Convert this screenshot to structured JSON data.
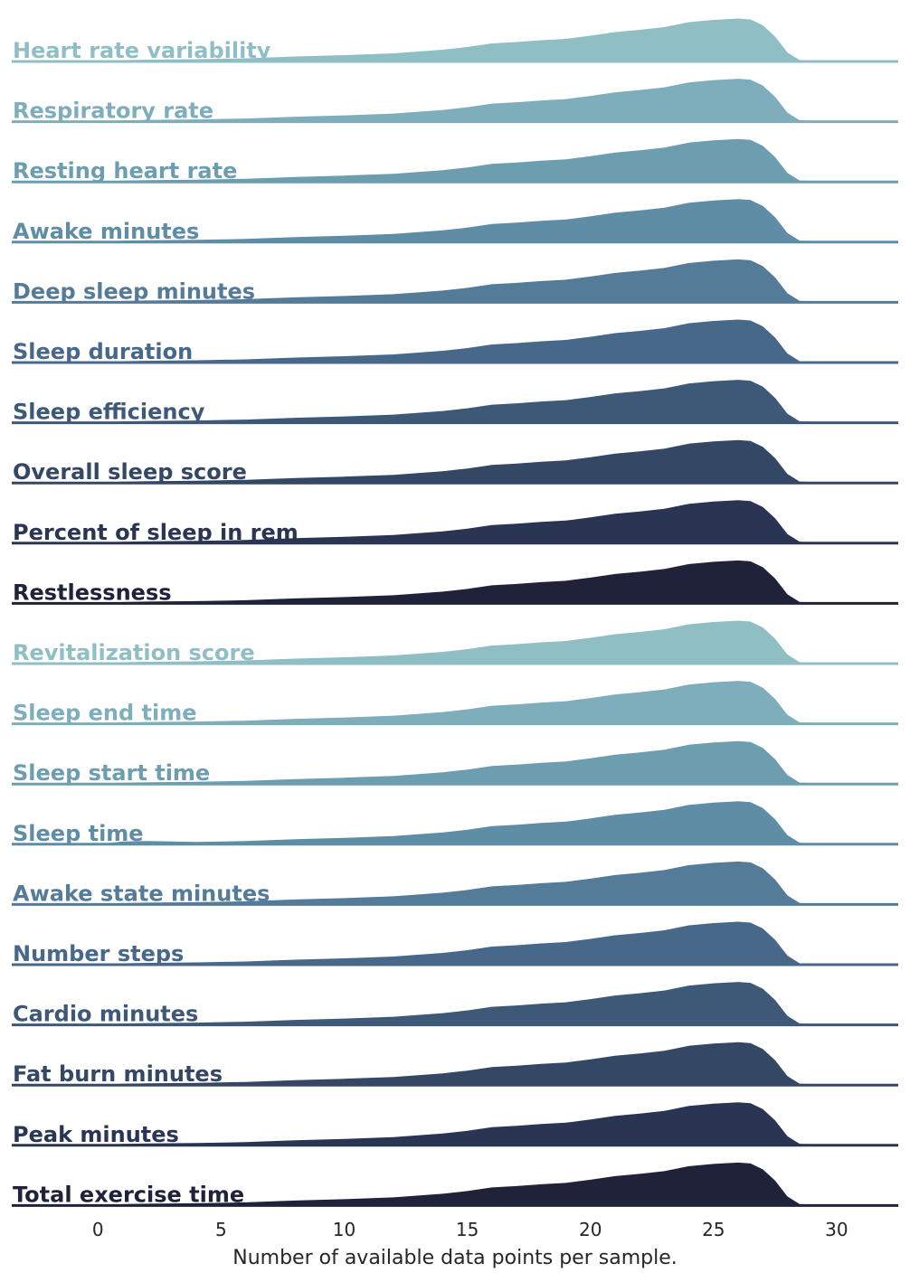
{
  "chart_data": {
    "type": "ridgeline",
    "xlabel": "Number of available data points per sample.",
    "xlim": [
      -3.5,
      32.5
    ],
    "xticks": [
      0,
      5,
      10,
      15,
      20,
      25,
      30
    ],
    "grid": false,
    "legend": "none",
    "density_grid_x": [
      -2,
      0,
      1,
      2,
      4,
      6,
      8,
      10,
      12,
      14,
      15,
      16,
      17,
      18,
      19,
      20,
      21,
      22,
      23,
      24,
      25,
      26,
      26.5,
      27,
      27.5,
      28,
      28.5,
      30.5
    ],
    "series": [
      {
        "name": "Heart rate variability",
        "color": "#8fbfc4",
        "density": [
          0,
          0,
          0.03,
          0.04,
          0.05,
          0.07,
          0.11,
          0.14,
          0.18,
          0.26,
          0.32,
          0.4,
          0.43,
          0.47,
          0.5,
          0.57,
          0.65,
          0.7,
          0.76,
          0.87,
          0.92,
          0.95,
          0.93,
          0.8,
          0.55,
          0.2,
          0.03,
          0
        ]
      },
      {
        "name": "Respiratory rate",
        "color": "#7eaebb",
        "density": [
          0,
          0,
          0.03,
          0.04,
          0.05,
          0.07,
          0.11,
          0.14,
          0.18,
          0.26,
          0.32,
          0.4,
          0.43,
          0.47,
          0.5,
          0.57,
          0.65,
          0.7,
          0.76,
          0.87,
          0.92,
          0.95,
          0.93,
          0.8,
          0.55,
          0.2,
          0.03,
          0
        ]
      },
      {
        "name": "Resting heart rate",
        "color": "#6d9eb0",
        "density": [
          0,
          0,
          0.03,
          0.04,
          0.05,
          0.07,
          0.11,
          0.14,
          0.18,
          0.26,
          0.32,
          0.4,
          0.43,
          0.47,
          0.5,
          0.57,
          0.65,
          0.7,
          0.76,
          0.87,
          0.92,
          0.95,
          0.93,
          0.8,
          0.55,
          0.2,
          0.03,
          0
        ]
      },
      {
        "name": "Awake minutes",
        "color": "#5f8da6",
        "density": [
          0,
          0,
          0.03,
          0.04,
          0.05,
          0.07,
          0.11,
          0.14,
          0.18,
          0.26,
          0.32,
          0.4,
          0.43,
          0.47,
          0.5,
          0.57,
          0.65,
          0.7,
          0.76,
          0.87,
          0.92,
          0.95,
          0.93,
          0.8,
          0.55,
          0.2,
          0.03,
          0
        ]
      },
      {
        "name": "Deep sleep minutes",
        "color": "#547b98",
        "density": [
          0,
          0,
          0.03,
          0.04,
          0.05,
          0.07,
          0.11,
          0.14,
          0.18,
          0.26,
          0.32,
          0.4,
          0.43,
          0.47,
          0.5,
          0.57,
          0.65,
          0.7,
          0.76,
          0.87,
          0.92,
          0.95,
          0.93,
          0.8,
          0.55,
          0.2,
          0.03,
          0
        ]
      },
      {
        "name": "Sleep duration",
        "color": "#486889",
        "density": [
          0,
          0,
          0.03,
          0.04,
          0.05,
          0.07,
          0.11,
          0.14,
          0.18,
          0.26,
          0.32,
          0.4,
          0.43,
          0.47,
          0.5,
          0.57,
          0.65,
          0.7,
          0.76,
          0.87,
          0.92,
          0.95,
          0.93,
          0.8,
          0.55,
          0.2,
          0.03,
          0
        ]
      },
      {
        "name": "Sleep efficiency",
        "color": "#3e5878",
        "density": [
          0,
          0,
          0.03,
          0.04,
          0.05,
          0.07,
          0.11,
          0.14,
          0.18,
          0.26,
          0.32,
          0.4,
          0.43,
          0.47,
          0.5,
          0.57,
          0.65,
          0.7,
          0.76,
          0.87,
          0.92,
          0.95,
          0.93,
          0.8,
          0.55,
          0.2,
          0.03,
          0
        ]
      },
      {
        "name": "Overall sleep score",
        "color": "#344866",
        "density": [
          0,
          0,
          0.03,
          0.04,
          0.05,
          0.07,
          0.11,
          0.14,
          0.18,
          0.26,
          0.32,
          0.4,
          0.43,
          0.47,
          0.5,
          0.57,
          0.65,
          0.7,
          0.76,
          0.87,
          0.92,
          0.95,
          0.93,
          0.8,
          0.55,
          0.2,
          0.03,
          0
        ]
      },
      {
        "name": "Percent of sleep in rem",
        "color": "#2a3554",
        "density": [
          0,
          0,
          0.03,
          0.04,
          0.05,
          0.07,
          0.11,
          0.14,
          0.18,
          0.26,
          0.32,
          0.4,
          0.43,
          0.47,
          0.5,
          0.57,
          0.65,
          0.7,
          0.76,
          0.87,
          0.92,
          0.95,
          0.93,
          0.8,
          0.55,
          0.2,
          0.03,
          0
        ]
      },
      {
        "name": "Restlessness",
        "color": "#20223a",
        "density": [
          0,
          0,
          0.03,
          0.04,
          0.05,
          0.07,
          0.11,
          0.14,
          0.18,
          0.26,
          0.32,
          0.4,
          0.43,
          0.47,
          0.5,
          0.57,
          0.65,
          0.7,
          0.76,
          0.87,
          0.92,
          0.95,
          0.93,
          0.8,
          0.55,
          0.2,
          0.03,
          0
        ]
      },
      {
        "name": "Revitalization score",
        "color": "#8fbfc4",
        "density": [
          0,
          0,
          0.03,
          0.04,
          0.05,
          0.07,
          0.11,
          0.14,
          0.18,
          0.26,
          0.32,
          0.4,
          0.43,
          0.47,
          0.5,
          0.57,
          0.65,
          0.7,
          0.76,
          0.87,
          0.92,
          0.95,
          0.93,
          0.8,
          0.55,
          0.2,
          0.03,
          0
        ]
      },
      {
        "name": "Sleep end time",
        "color": "#7eaebb",
        "density": [
          0,
          0,
          0.03,
          0.04,
          0.05,
          0.07,
          0.11,
          0.14,
          0.18,
          0.26,
          0.32,
          0.4,
          0.43,
          0.47,
          0.5,
          0.57,
          0.65,
          0.7,
          0.76,
          0.87,
          0.92,
          0.95,
          0.93,
          0.8,
          0.55,
          0.2,
          0.03,
          0
        ]
      },
      {
        "name": "Sleep start time",
        "color": "#6d9eb0",
        "density": [
          0,
          0,
          0.03,
          0.04,
          0.05,
          0.07,
          0.11,
          0.14,
          0.18,
          0.26,
          0.32,
          0.4,
          0.43,
          0.47,
          0.5,
          0.57,
          0.65,
          0.7,
          0.76,
          0.87,
          0.92,
          0.95,
          0.93,
          0.8,
          0.55,
          0.2,
          0.03,
          0
        ]
      },
      {
        "name": "Sleep time",
        "color": "#5f8da6",
        "density": [
          0,
          0,
          0.06,
          0.07,
          0.05,
          0.07,
          0.11,
          0.14,
          0.18,
          0.26,
          0.32,
          0.4,
          0.43,
          0.47,
          0.5,
          0.57,
          0.65,
          0.7,
          0.76,
          0.87,
          0.92,
          0.95,
          0.93,
          0.8,
          0.55,
          0.2,
          0.03,
          0
        ]
      },
      {
        "name": "Awake state minutes",
        "color": "#547b98",
        "density": [
          0,
          0,
          0.03,
          0.04,
          0.05,
          0.07,
          0.11,
          0.14,
          0.18,
          0.26,
          0.32,
          0.4,
          0.43,
          0.47,
          0.5,
          0.57,
          0.65,
          0.7,
          0.76,
          0.87,
          0.92,
          0.95,
          0.93,
          0.8,
          0.55,
          0.2,
          0.03,
          0
        ]
      },
      {
        "name": "Number steps",
        "color": "#486889",
        "density": [
          0,
          0,
          0.03,
          0.04,
          0.05,
          0.07,
          0.11,
          0.14,
          0.18,
          0.26,
          0.32,
          0.4,
          0.43,
          0.47,
          0.5,
          0.57,
          0.65,
          0.7,
          0.76,
          0.87,
          0.92,
          0.95,
          0.93,
          0.8,
          0.55,
          0.2,
          0.03,
          0
        ]
      },
      {
        "name": "Cardio minutes",
        "color": "#3e5878",
        "density": [
          0,
          0,
          0.03,
          0.04,
          0.05,
          0.07,
          0.11,
          0.14,
          0.18,
          0.26,
          0.32,
          0.4,
          0.43,
          0.47,
          0.5,
          0.57,
          0.65,
          0.7,
          0.76,
          0.87,
          0.92,
          0.95,
          0.93,
          0.8,
          0.55,
          0.2,
          0.03,
          0
        ]
      },
      {
        "name": "Fat burn minutes",
        "color": "#344866",
        "density": [
          0,
          0,
          0.03,
          0.04,
          0.05,
          0.07,
          0.11,
          0.14,
          0.18,
          0.26,
          0.32,
          0.4,
          0.43,
          0.47,
          0.5,
          0.57,
          0.65,
          0.7,
          0.76,
          0.87,
          0.92,
          0.95,
          0.93,
          0.8,
          0.55,
          0.2,
          0.03,
          0
        ]
      },
      {
        "name": "Peak minutes",
        "color": "#2a3554",
        "density": [
          0,
          0,
          0.03,
          0.04,
          0.05,
          0.07,
          0.11,
          0.14,
          0.18,
          0.26,
          0.32,
          0.4,
          0.43,
          0.47,
          0.5,
          0.57,
          0.65,
          0.7,
          0.76,
          0.87,
          0.92,
          0.95,
          0.93,
          0.8,
          0.55,
          0.2,
          0.03,
          0
        ]
      },
      {
        "name": "Total exercise time",
        "color": "#20223a",
        "density": [
          0,
          0,
          0.03,
          0.04,
          0.05,
          0.07,
          0.11,
          0.14,
          0.18,
          0.26,
          0.32,
          0.4,
          0.43,
          0.47,
          0.5,
          0.57,
          0.65,
          0.7,
          0.76,
          0.87,
          0.92,
          0.95,
          0.93,
          0.8,
          0.55,
          0.2,
          0.03,
          0
        ]
      }
    ]
  }
}
